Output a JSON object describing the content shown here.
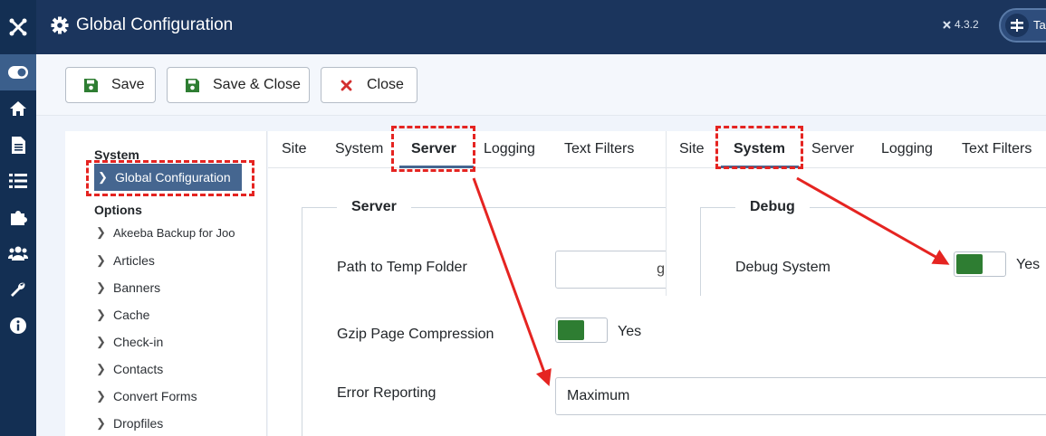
{
  "header": {
    "title": "Global Configuration",
    "version": "4.3.2",
    "user_text": "Ta"
  },
  "toolbar": {
    "save_label": "Save",
    "save_close_label": "Save & Close",
    "close_label": "Close"
  },
  "sidebar": {
    "system_heading": "System",
    "active_item": "Global Configuration",
    "options_heading": "Options",
    "items": [
      "Akeeba Backup for Joo",
      "Articles",
      "Banners",
      "Cache",
      "Check-in",
      "Contacts",
      "Convert Forms",
      "Dropfiles"
    ]
  },
  "left_panel": {
    "tabs": [
      "Site",
      "System",
      "Server",
      "Logging",
      "Text Filters"
    ],
    "selected_tab": "Server",
    "legend": "Server",
    "path_label": "Path to Temp Folder",
    "path_value": "g",
    "gzip_label": "Gzip Page Compression",
    "gzip_value": "Yes",
    "error_label": "Error Reporting",
    "error_value": "Maximum"
  },
  "right_panel": {
    "tabs": [
      "Site",
      "System",
      "Server",
      "Logging",
      "Text Filters"
    ],
    "selected_tab": "System",
    "legend": "Debug",
    "debug_label": "Debug System",
    "debug_value": "Yes"
  },
  "colors": {
    "rail": "#132f53",
    "header": "#1b355d",
    "accent": "#456690",
    "switch_on": "#2e7d32",
    "annotation": "#e52421"
  }
}
